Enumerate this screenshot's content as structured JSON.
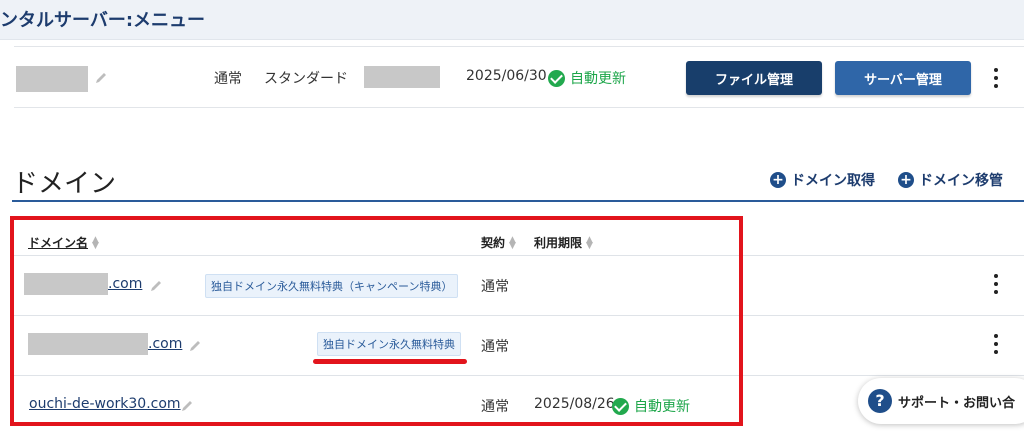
{
  "header": {
    "title": "ンタルサーバー:メニュー"
  },
  "server": {
    "plan_type": "通常",
    "plan_name": "スタンダード",
    "expiry": "2025/06/30",
    "auto_renew": "自動更新",
    "file_button": "ファイル管理",
    "server_button": "サーバー管理"
  },
  "domain_section": {
    "title": "ドメイン",
    "acquire": "ドメイン取得",
    "transfer": "ドメイン移管",
    "columns": {
      "name": "ドメイン名",
      "contract": "契約",
      "expiry": "利用期限"
    },
    "rows": [
      {
        "domain": ".com",
        "badge": "独自ドメイン永久無料特典（キャンペーン特典）",
        "contract": "通常",
        "expiry": "",
        "auto_renew": ""
      },
      {
        "domain": ".com",
        "badge": "独自ドメイン永久無料特典",
        "contract": "通常",
        "expiry": "",
        "auto_renew": ""
      },
      {
        "domain": "ouchi-de-work30.com",
        "badge": "",
        "contract": "通常",
        "expiry": "2025/08/26",
        "auto_renew": "自動更新"
      }
    ]
  },
  "support": {
    "label": "サポート・お問い合"
  },
  "colors": {
    "accent": "#1d3c6e",
    "button_dark": "#183e6b",
    "button_blue": "#2f66a8",
    "success": "#1da64a",
    "highlight": "#e2141c"
  },
  "icons": [
    "pencil-icon",
    "check-circle-icon",
    "kebab-menu-icon",
    "plus-circle-icon",
    "sort-icon",
    "question-icon"
  ]
}
